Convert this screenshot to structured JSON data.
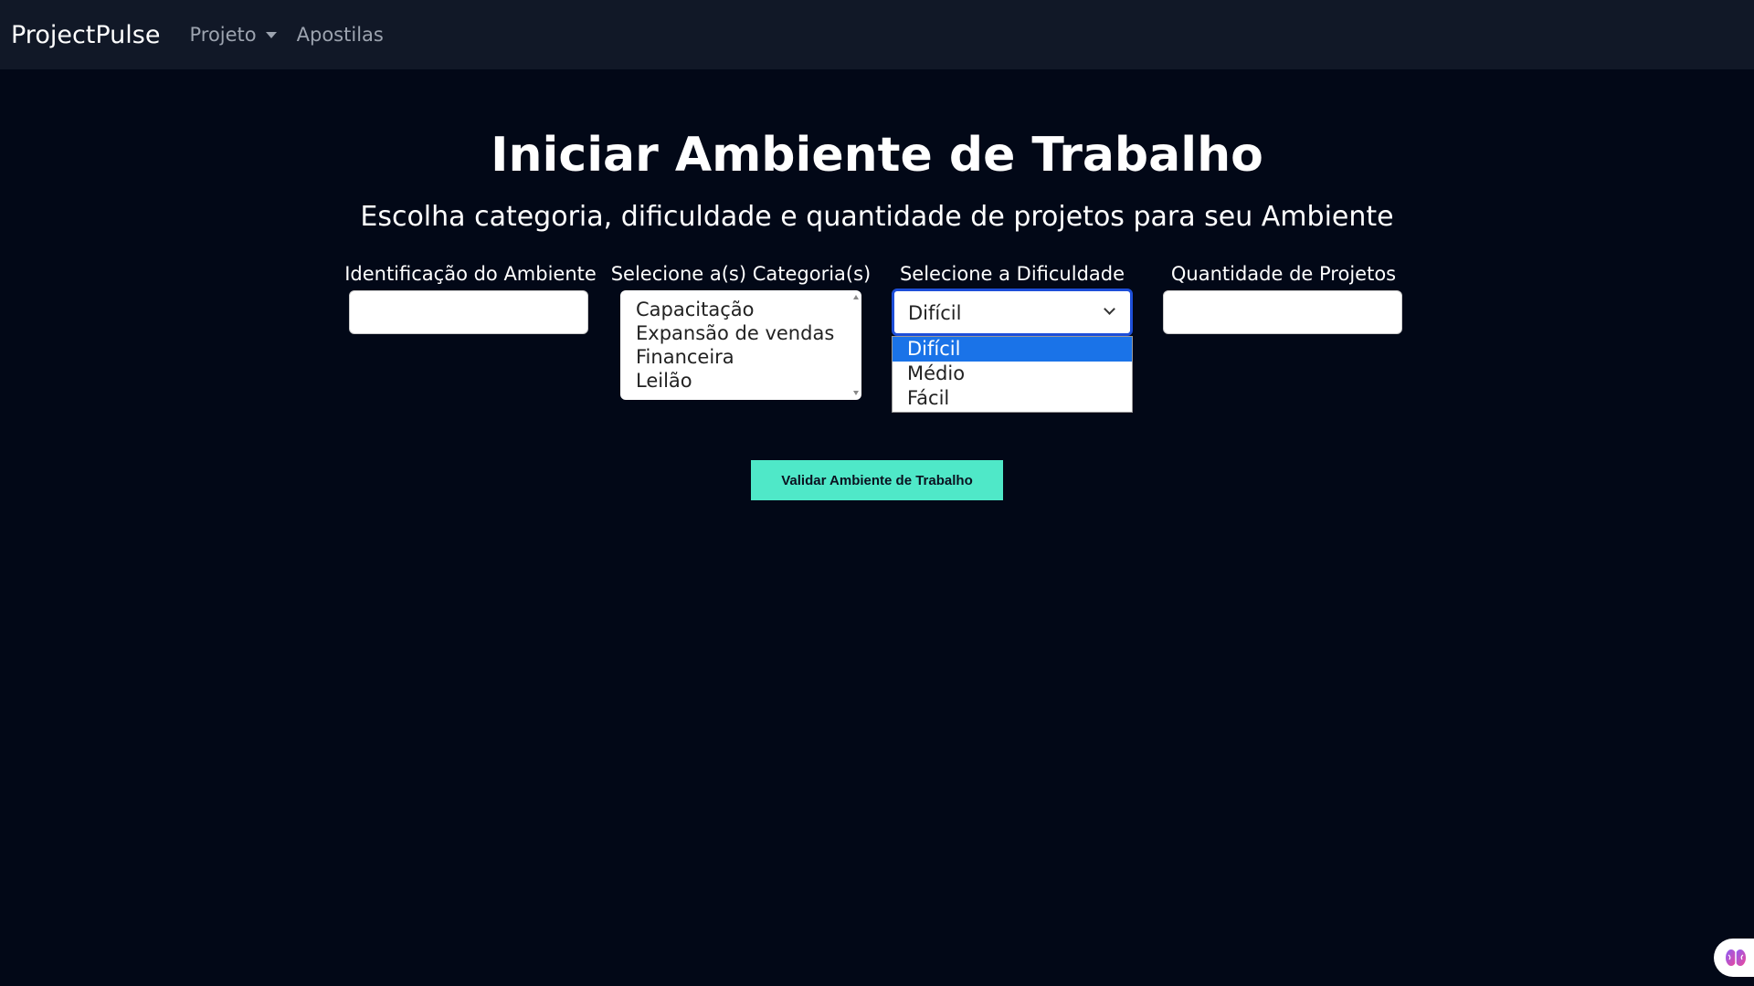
{
  "navbar": {
    "brand": "ProjectPulse",
    "links": [
      {
        "label": "Projeto",
        "has_dropdown": true
      },
      {
        "label": "Apostilas",
        "has_dropdown": false
      }
    ]
  },
  "page": {
    "title": "Iniciar Ambiente de Trabalho",
    "subtitle": "Escolha categoria, dificuldade e quantidade de projetos para seu Ambiente"
  },
  "form": {
    "environment_id": {
      "label": "Identificação do Ambiente",
      "value": ""
    },
    "categories": {
      "label": "Selecione a(s) Categoria(s)",
      "options": [
        "Capacitação",
        "Expansão de vendas",
        "Financeira",
        "Leilão"
      ]
    },
    "difficulty": {
      "label": "Selecione a Dificuldade",
      "value": "Difícil",
      "options": [
        "Difícil",
        "Médio",
        "Fácil"
      ],
      "highlighted_option": "Difícil"
    },
    "project_count": {
      "label": "Quantidade de Projetos",
      "value": ""
    },
    "submit_label": "Validar Ambiente de Trabalho"
  },
  "colors": {
    "background": "#020817",
    "navbar": "#111827",
    "accent_button": "#4fe8c8",
    "select_focus": "#1d4ed8",
    "option_highlight": "#1a73e8"
  },
  "icons": {
    "assistant_fab": "brain-icon"
  }
}
